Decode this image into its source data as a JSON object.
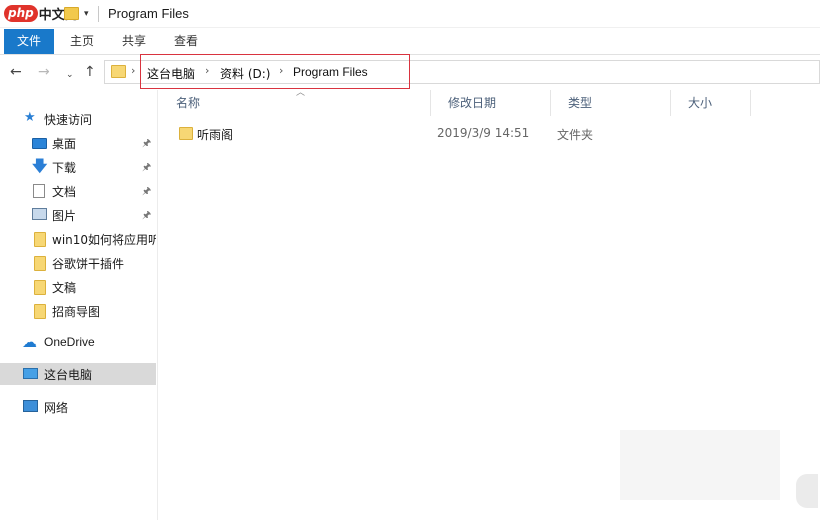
{
  "watermark": {
    "badge": "php",
    "text": "中文网"
  },
  "window": {
    "title": "Program Files"
  },
  "quick_access_toolbar": {
    "dropdown_glyph": "▾"
  },
  "ribbon": {
    "tabs": [
      {
        "label": "文件",
        "active": true
      },
      {
        "label": "主页"
      },
      {
        "label": "共享"
      },
      {
        "label": "查看"
      }
    ],
    "active_color": "#1979ca"
  },
  "navigation": {
    "back_glyph": "←",
    "forward_glyph": "→",
    "recent_glyph": "⌄",
    "up_glyph": "↑"
  },
  "address_bar": {
    "breadcrumbs": [
      "这台电脑",
      "资料 (D:)",
      "Program Files"
    ],
    "highlight_color": "#d9333f"
  },
  "nav_pane": {
    "quick_access": "快速访问",
    "items": [
      {
        "label": "桌面",
        "icon": "desktop-icon",
        "pinned": true
      },
      {
        "label": "下载",
        "icon": "download-icon",
        "pinned": true
      },
      {
        "label": "文档",
        "icon": "document-icon",
        "pinned": true
      },
      {
        "label": "图片",
        "icon": "picture-icon",
        "pinned": true
      },
      {
        "label": "win10如何将应用听",
        "icon": "folder-icon"
      },
      {
        "label": "谷歌饼干插件",
        "icon": "folder-icon"
      },
      {
        "label": "文稿",
        "icon": "folder-icon"
      },
      {
        "label": "招商导图",
        "icon": "folder-icon"
      }
    ],
    "onedrive": "OneDrive",
    "this_pc": "这台电脑",
    "network": "网络",
    "pin_glyph": "📌"
  },
  "columns": {
    "name": "名称",
    "modified": "修改日期",
    "type": "类型",
    "size": "大小"
  },
  "files": [
    {
      "name": "听雨阁",
      "modified": "2019/3/9 14:51",
      "type": "文件夹",
      "size": ""
    }
  ]
}
